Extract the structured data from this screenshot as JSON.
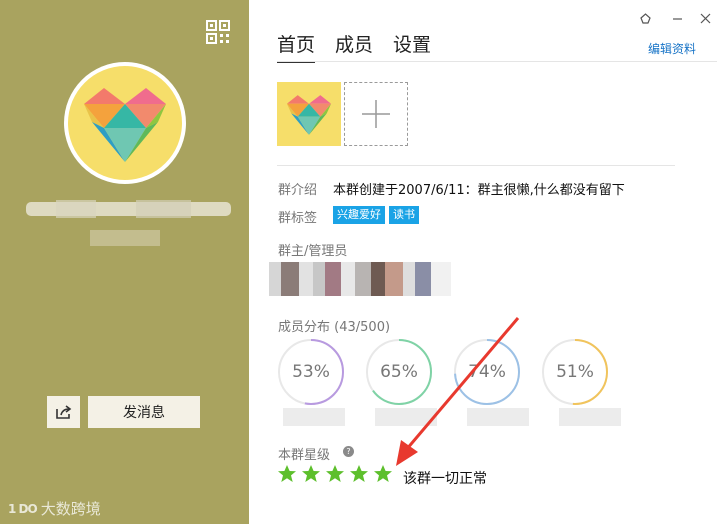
{
  "left_panel": {
    "send_message_label": "发消息",
    "watermark_text": "大数跨境",
    "watermark_logo": "1 DO",
    "bg_color": "#a9a35f"
  },
  "window": {
    "controls": [
      "settings-icon",
      "minimize-icon",
      "close-icon"
    ]
  },
  "tabs": [
    {
      "label": "首页",
      "active": true
    },
    {
      "label": "成员",
      "active": false
    },
    {
      "label": "设置",
      "active": false
    }
  ],
  "edit_profile_label": "编辑资料",
  "group_info": {
    "intro_label": "群介绍",
    "intro_value": "本群创建于2007/6/11：群主很懒,什么都没有留下",
    "tags_label": "群标签",
    "tags": [
      "兴趣爱好",
      "读书"
    ],
    "tag_color": "#1aa3e6",
    "admin_label": "群主/管理员",
    "distribution_label": "成员分布",
    "distribution_count": "(43/500)",
    "distribution": [
      {
        "percent": 53,
        "text": "53%",
        "color": "#b89ae0"
      },
      {
        "percent": 65,
        "text": "65%",
        "color": "#7fd3a6"
      },
      {
        "percent": 74,
        "text": "74%",
        "color": "#9cc1e6"
      },
      {
        "percent": 51,
        "text": "51%",
        "color": "#f1c45c"
      }
    ],
    "rating_label": "本群星级",
    "rating_stars": 5,
    "star_color": "#5dbf2c",
    "rating_status": "该群一切正常"
  },
  "annotation_color": "#e8392e"
}
